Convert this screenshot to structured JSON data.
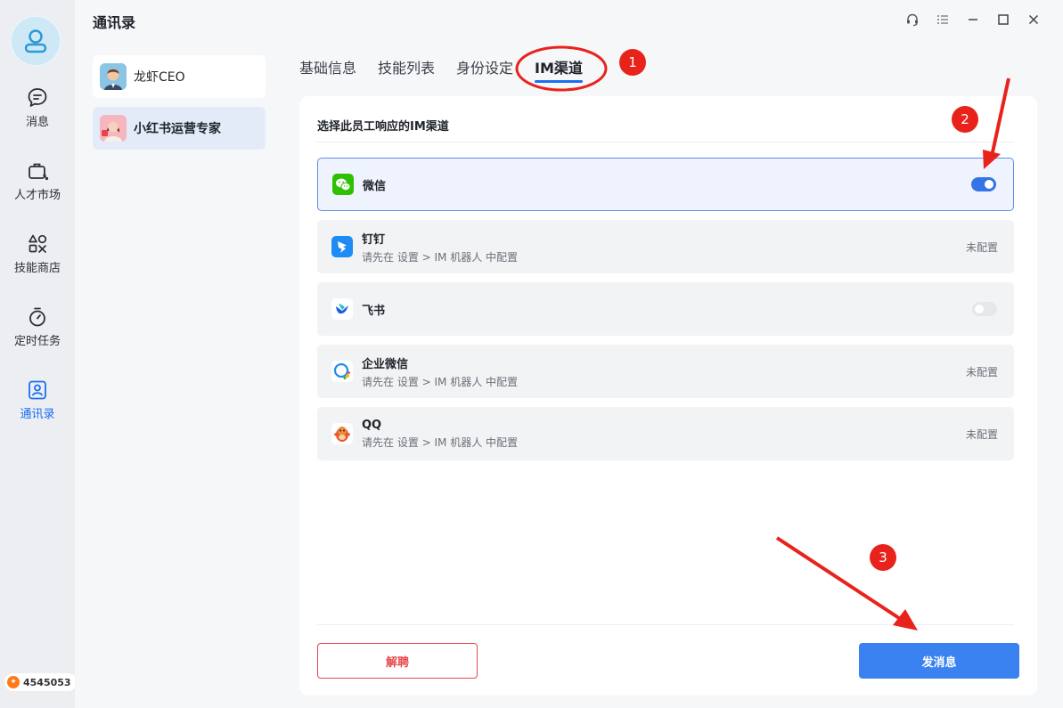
{
  "sidebar": {
    "items": [
      {
        "label": "消息",
        "icon": "message-icon"
      },
      {
        "label": "人才市场",
        "icon": "briefcase-icon"
      },
      {
        "label": "技能商店",
        "icon": "skills-icon"
      },
      {
        "label": "定时任务",
        "icon": "timer-icon"
      },
      {
        "label": "通讯录",
        "icon": "contacts-icon"
      }
    ],
    "active": "通讯录",
    "credits": "4545053"
  },
  "header": {
    "title": "通讯录"
  },
  "contacts": [
    {
      "name": "龙虾CEO"
    },
    {
      "name": "小红书运营专家"
    }
  ],
  "tabs": [
    {
      "label": "基础信息"
    },
    {
      "label": "技能列表"
    },
    {
      "label": "身份设定"
    },
    {
      "label": "IM渠道"
    }
  ],
  "panel": {
    "title": "选择此员工响应的IM渠道",
    "channels": [
      {
        "name": "微信",
        "hint": "",
        "status": "",
        "enabled": true
      },
      {
        "name": "钉钉",
        "hint": "请先在 设置 > IM 机器人 中配置",
        "status": "未配置"
      },
      {
        "name": "飞书",
        "hint": "",
        "status": "",
        "enabled": false
      },
      {
        "name": "企业微信",
        "hint": "请先在 设置 > IM 机器人 中配置",
        "status": "未配置"
      },
      {
        "name": "QQ",
        "hint": "请先在 设置 > IM 机器人 中配置",
        "status": "未配置"
      }
    ]
  },
  "actions": {
    "fire_label": "解聘",
    "send_label": "发消息"
  },
  "annotations": [
    "1",
    "2",
    "3"
  ],
  "colors": {
    "accent": "#3a82f0",
    "danger": "#e5484d",
    "annotation": "#e8231c",
    "wechat": "#2dc100"
  }
}
